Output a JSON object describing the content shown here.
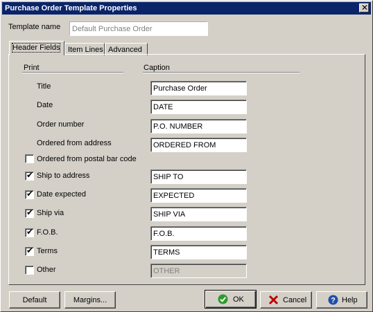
{
  "window": {
    "title": "Purchase Order Template Properties"
  },
  "template_name": {
    "label": "Template name",
    "value": "Default Purchase Order"
  },
  "tabs": [
    {
      "label": "Header Fields"
    },
    {
      "label": "Item Lines"
    },
    {
      "label": "Advanced"
    }
  ],
  "columns": {
    "print": "Print",
    "caption": "Caption"
  },
  "rows": [
    {
      "label": "Title",
      "caption": "Purchase Order"
    },
    {
      "label": "Date",
      "caption": "DATE"
    },
    {
      "label": "Order number",
      "caption": "P.O. NUMBER"
    },
    {
      "label": "Ordered from address",
      "caption": "ORDERED FROM"
    },
    {
      "label": "Ordered from postal bar code",
      "checked": false
    },
    {
      "label": "Ship to address",
      "checked": true,
      "caption": "SHIP TO"
    },
    {
      "label": "Date expected",
      "checked": true,
      "caption": "EXPECTED"
    },
    {
      "label": "Ship via",
      "checked": true,
      "caption": "SHIP VIA"
    },
    {
      "label": "F.O.B.",
      "checked": true,
      "caption": "F.O.B."
    },
    {
      "label": "Terms",
      "checked": true,
      "caption": "TERMS"
    },
    {
      "label": "Other",
      "checked": false,
      "caption": "OTHER",
      "disabled": true
    }
  ],
  "buttons": {
    "default": "Default",
    "margins": "Margins...",
    "ok": "OK",
    "cancel": "Cancel",
    "help": "Help"
  },
  "check_glyph": "✔",
  "colors": {
    "titlebar": "#0a246a",
    "ok_icon": "#2e9a2e",
    "cancel_icon": "#c00000",
    "help_icon": "#1f4fa8"
  }
}
